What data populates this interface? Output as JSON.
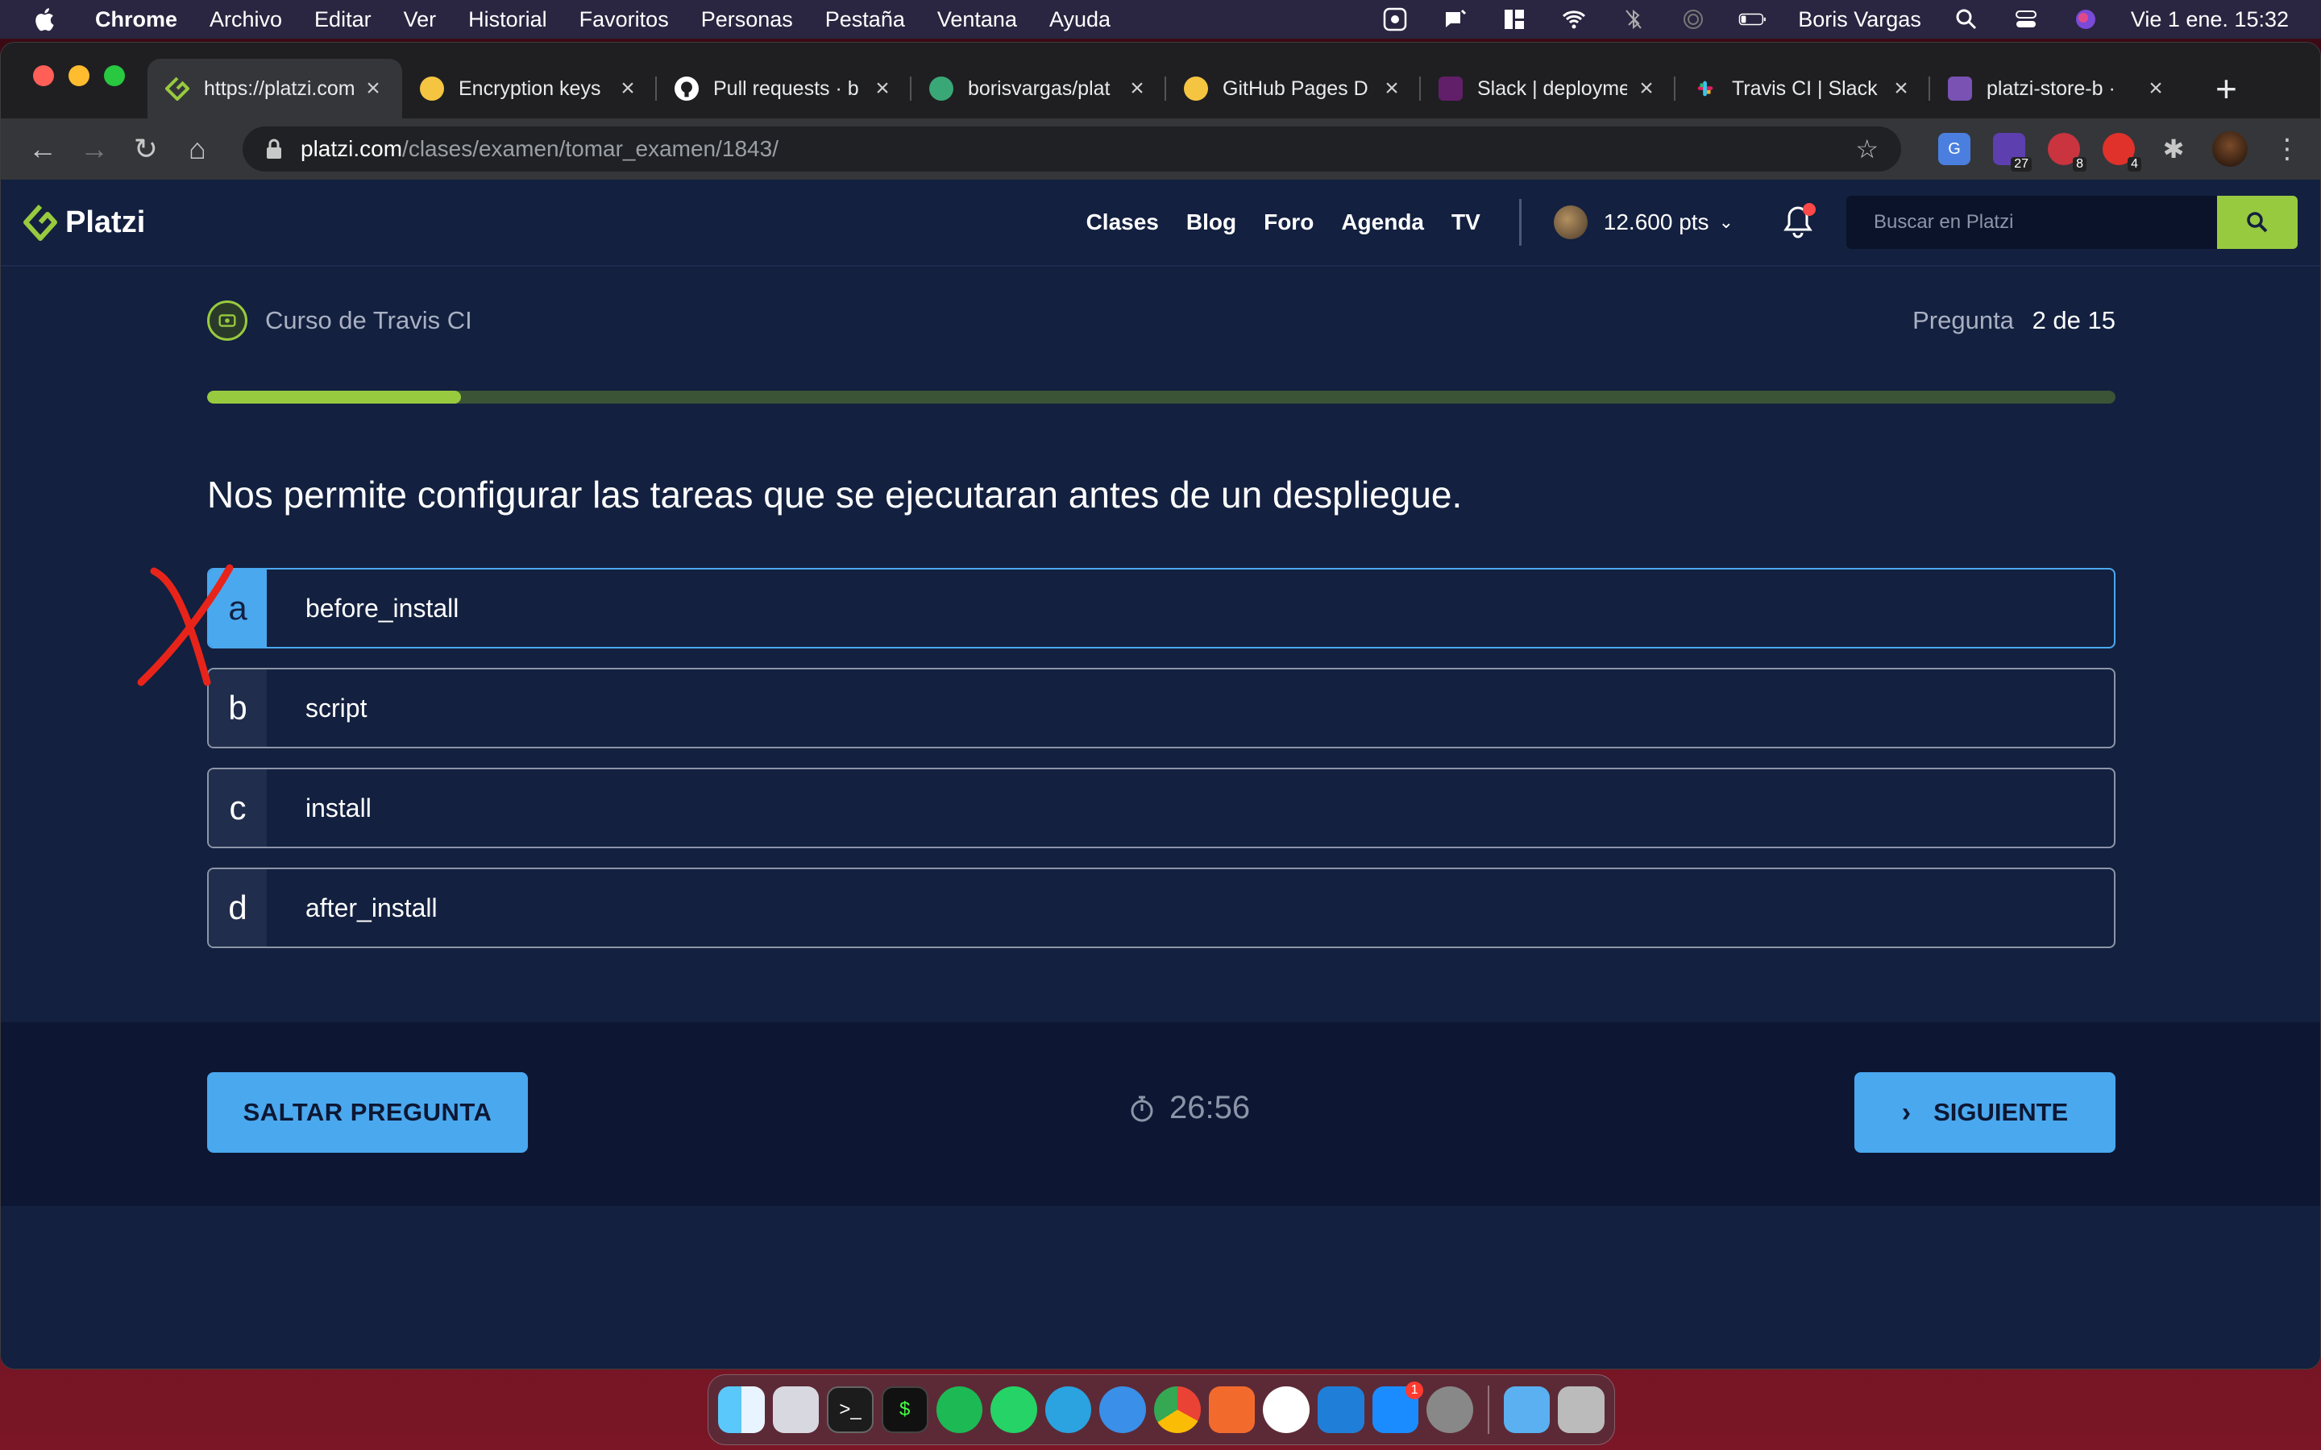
{
  "menubar": {
    "app": "Chrome",
    "items": [
      "Archivo",
      "Editar",
      "Ver",
      "Historial",
      "Favoritos",
      "Personas",
      "Pestaña",
      "Ventana",
      "Ayuda"
    ],
    "user": "Boris Vargas",
    "datetime": "Vie 1 ene.  15:32"
  },
  "tabs": [
    {
      "title": "https://platzi.com",
      "icon": "platzi-icon"
    },
    {
      "title": "Encryption keys",
      "icon": "travis-icon"
    },
    {
      "title": "Pull requests · b",
      "icon": "github-icon"
    },
    {
      "title": "borisvargas/plat",
      "icon": "globe-icon"
    },
    {
      "title": "GitHub Pages D",
      "icon": "travis-icon"
    },
    {
      "title": "Slack | deployme",
      "icon": "slack-icon"
    },
    {
      "title": "Travis CI | Slack",
      "icon": "slack-icon"
    },
    {
      "title": "platzi-store-b · ",
      "icon": "heroku-icon"
    }
  ],
  "address": {
    "host": "platzi.com",
    "path": "/clases/examen/tomar_examen/1843/"
  },
  "extensions": {
    "badge_1": "27",
    "badge_2": "8",
    "badge_3": "4"
  },
  "site": {
    "logo_text": "Platzi",
    "nav": [
      "Clases",
      "Blog",
      "Foro",
      "Agenda",
      "TV"
    ],
    "points": "12.600 pts",
    "search_placeholder": "Buscar en Platzi"
  },
  "exam": {
    "course": "Curso de Travis CI",
    "progress_label": "Pregunta",
    "progress_count": "2 de 15",
    "progress_fraction": 0.133,
    "question": "Nos permite configurar las tareas que se ejecutaran antes de un despliegue.",
    "options": [
      {
        "letter": "a",
        "text": "before_install",
        "selected": true
      },
      {
        "letter": "b",
        "text": "script",
        "selected": false
      },
      {
        "letter": "c",
        "text": "install",
        "selected": false
      },
      {
        "letter": "d",
        "text": "after_install",
        "selected": false
      }
    ],
    "skip_label": "SALTAR PREGUNTA",
    "timer": "26:56",
    "next_label": "SIGUIENTE"
  },
  "dock": {
    "appstore_badge": "1"
  },
  "colors": {
    "page_bg": "#13203f",
    "accent_blue": "#4aa8ef",
    "accent_green": "#98ca3f",
    "progress_track": "#3b5436"
  }
}
